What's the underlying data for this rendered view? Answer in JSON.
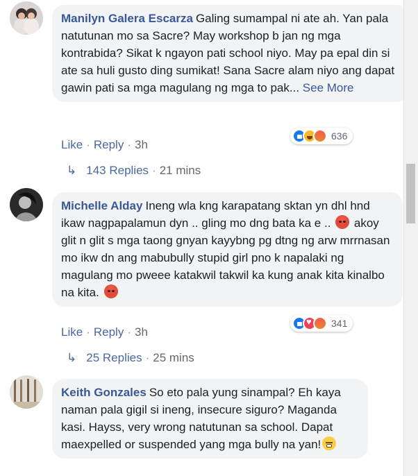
{
  "comments": [
    {
      "author": "Manilyn Galera Escarza",
      "text": "Galing sumampal ni ate ah. Yan pala natutunan mo sa Sacre? May workshop b jan ng mga kontrabida? Sikat k ngayon pati school niyo. May pa epal din si ate sa huli gusto ding sumikat! Sana Sacre alam niyo ang dapat gawin pati sa mga magulang ng mga to pak...",
      "see_more": "See More",
      "reaction_count": "636",
      "reaction_icons": [
        "like-icon",
        "haha-icon",
        "angry-icon"
      ],
      "like_label": "Like",
      "reply_label": "Reply",
      "time": "3h",
      "replies_label": "143 Replies",
      "replies_time": "21 mins"
    },
    {
      "author": "Michelle Alday",
      "text_part1": "Ineng wla kng karapatang sktan yn dhl hnd ikaw nagpapalamun dyn .. gling mo dng bata ka e ..",
      "text_part2": "akoy glit n glit s mga taong gnyan kayybng pg dtng ng arw mrrnasan mo ikw dn ang mabubully stupid girl pno k napalaki ng magulang mo pweee katakwil takwil ka kung anak kita kinalbo na kita.",
      "reaction_count": "341",
      "reaction_icons": [
        "like-icon",
        "love-icon",
        "angry-icon"
      ],
      "like_label": "Like",
      "reply_label": "Reply",
      "time": "3h",
      "replies_label": "25 Replies",
      "replies_time": "25 mins"
    },
    {
      "author": "Keith Gonzales",
      "text": "So eto pala yung sinampal? Eh kaya naman pala gigil si ineng, insecure siguro? Maganda kasi. Hayss, very wrong natutunan sa school. Dapat maexpelled or suspended yang mga bully na yan!"
    }
  ],
  "colors": {
    "author_link": "#385898",
    "action_link": "#4b67a1",
    "bubble_bg": "#f2f3f5",
    "muted": "#606770"
  }
}
